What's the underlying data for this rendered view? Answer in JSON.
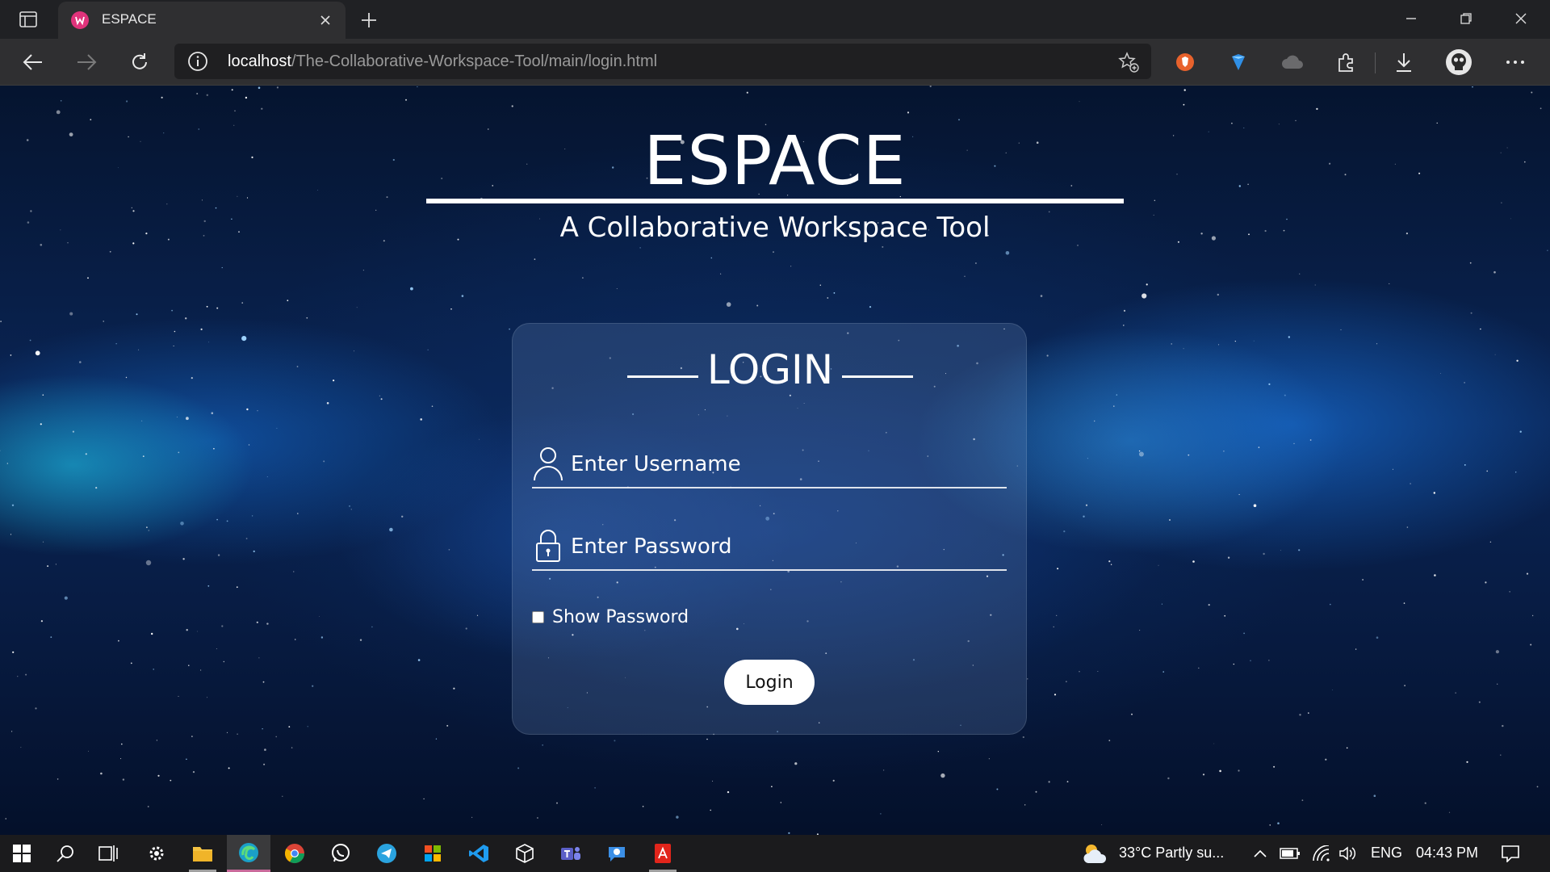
{
  "browser": {
    "tab_title": "ESPACE",
    "url_host": "localhost",
    "url_path": "/The-Collaborative-Workspace-Tool/main/login.html"
  },
  "page": {
    "brand": "ESPACE",
    "subtitle": "A Collaborative Workspace Tool",
    "login": {
      "title": "LOGIN",
      "username_placeholder": "Enter Username",
      "password_placeholder": "Enter Password",
      "show_password_label": "Show Password",
      "button_label": "Login"
    }
  },
  "taskbar": {
    "weather": "33°C  Partly su...",
    "language": "ENG",
    "time": "04:43 PM"
  },
  "icons": {
    "tab_favicon": "espace-favicon",
    "username_field": "user-icon",
    "password_field": "lock-icon"
  },
  "colors": {
    "favicon": "#e0337b",
    "taskbar_active": "#c96a9a"
  }
}
